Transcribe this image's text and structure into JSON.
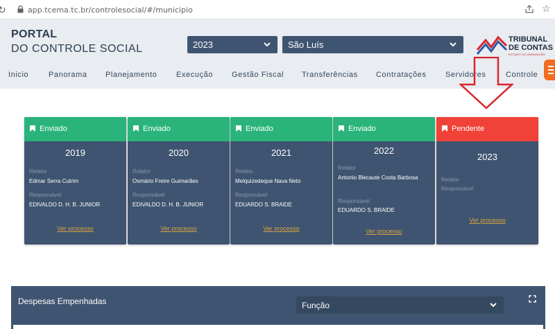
{
  "browser": {
    "url": "app.tcema.tc.br/controlesocial/#/municipio"
  },
  "brand": {
    "line1": "PORTAL",
    "line2": "DO CONTROLE SOCIAL"
  },
  "filters": {
    "year": "2023",
    "city": "São Luís"
  },
  "logo": {
    "line1": "TRIBUNAL",
    "line2": "DE CONTAS",
    "subtitle": "ESTADO DO MARANHÃO"
  },
  "nav": {
    "items": [
      "Inicio",
      "Panorama",
      "Planejamento",
      "Execução",
      "Gestão Fiscal",
      "Transferências",
      "Contratações",
      "Servidores",
      "Controle"
    ]
  },
  "cards": [
    {
      "status": "Enviado",
      "year": "2019",
      "relator_label": "Relator",
      "relator": "Edmar Serra Cutrim",
      "responsavel_label": "Responsável",
      "responsavel": "EDIVALDO D. H. B. JUNIOR",
      "link": "Ver processo"
    },
    {
      "status": "Enviado",
      "year": "2020",
      "relator_label": "Relator",
      "relator": "Osmário Freire Guimarães",
      "responsavel_label": "Responsável",
      "responsavel": "EDIVALDO D. H. B. JUNIOR",
      "link": "Ver processo"
    },
    {
      "status": "Enviado",
      "year": "2021",
      "relator_label": "Relator",
      "relator": "Melquizedeque Nava Neto",
      "responsavel_label": "Responsável",
      "responsavel": "EDUARDO S. BRAIDE",
      "link": "Ver processo"
    },
    {
      "status": "Enviado",
      "year": "2022",
      "relator_label": "Relator",
      "relator": "Antonio Blecaute Costa Barbosa",
      "responsavel_label": "Responsável",
      "responsavel": "EDUARDO S. BRAIDE",
      "link": "Ver processo"
    },
    {
      "status": "Pendente",
      "year": "2023",
      "relator_label": "Relator",
      "responsavel_label": "Responsável",
      "link": "Ver processo"
    }
  ],
  "panel": {
    "title": "Despesas Empenhadas",
    "select": "Função"
  },
  "colors": {
    "navy": "#3f5470",
    "sent": "#2ab47b",
    "pending": "#f04238",
    "link": "#d9a441",
    "header_bg": "#e9ecf1",
    "accent": "#f26b21"
  }
}
